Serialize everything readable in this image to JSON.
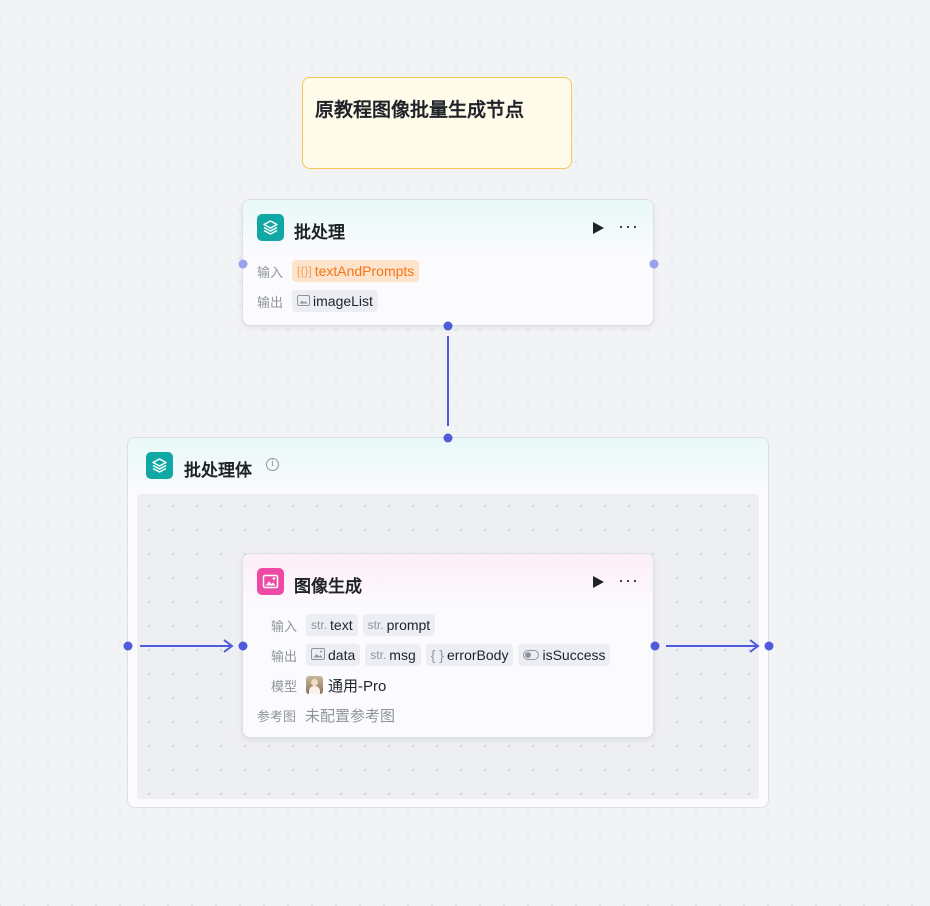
{
  "note": {
    "text": "原教程图像批量生成节点"
  },
  "batch_node": {
    "title": "批处理",
    "input_label": "输入",
    "output_label": "输出",
    "input_tag": {
      "prefix": "[{}]",
      "name": "textAndPrompts"
    },
    "output_tag": {
      "name": "imageList"
    },
    "icon": "layers-icon"
  },
  "batch_body": {
    "title": "批处理体",
    "icon": "layers-icon"
  },
  "image_gen_node": {
    "title": "图像生成",
    "icon": "image-generate-icon",
    "input_label": "输入",
    "output_label": "输出",
    "model_label": "模型",
    "ref_label": "参考图",
    "inputs": [
      {
        "prefix": "str.",
        "name": "text"
      },
      {
        "prefix": "str.",
        "name": "prompt"
      }
    ],
    "outputs": [
      {
        "prefix": "",
        "name": "data",
        "icon": "image-icon"
      },
      {
        "prefix": "str.",
        "name": "msg"
      },
      {
        "prefix": "{ }",
        "name": "errorBody"
      },
      {
        "prefix": "",
        "name": "isSuccess",
        "icon": "toggle-icon"
      }
    ],
    "model_value": "通用-Pro",
    "ref_value": "未配置参考图"
  },
  "colors": {
    "edge": "#4f5bdc",
    "teal": "#0fa8a4",
    "pink": "#ee4aa5",
    "note_border": "#f5c65b",
    "orange_tag": "#f57414"
  }
}
